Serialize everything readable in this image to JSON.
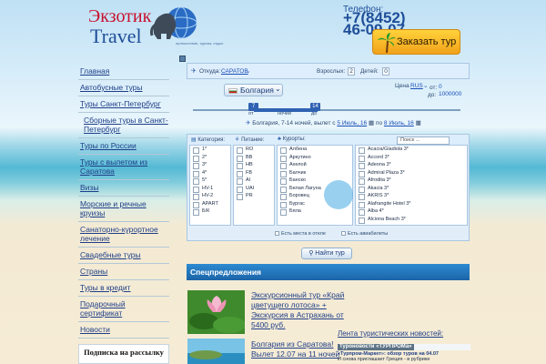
{
  "logo": {
    "line1": "Экзотик",
    "line2": "Travel",
    "tagline": "путешествия, туризм, отдых"
  },
  "contact": {
    "phone_label": "Телефон:",
    "phone_number": "+7(8452) 46-09-07"
  },
  "order_button": {
    "label": "Заказать тур"
  },
  "menu": {
    "items": [
      "Главная",
      "Автобусные туры",
      "Туры Санкт-Петербург",
      "Сборные туры в Санкт-Петербург",
      "Туры по России",
      "Туры с вылетом из Саратова",
      "Визы",
      "Морские и речные круизы",
      "Санаторно-курортное лечение",
      "Свадебные туры",
      "Страны",
      "Туры в кредит",
      "Подарочный сертификат",
      "Новости"
    ]
  },
  "subscribe": {
    "label": "Подписка на рассылку"
  },
  "search": {
    "from_label": "Откуда:",
    "from_value": "САРАТОВ",
    "adults_label": "Взрослых:",
    "adults_value": "2",
    "children_label": "Детей:",
    "children_value": "0",
    "country": "Болгария",
    "price_label": "Цена",
    "currency": "RUS",
    "price_from_label": "от:",
    "price_from": "0",
    "price_to_label": "до:",
    "price_to": "1000000",
    "nights_from": "7",
    "nights_to": "14",
    "nights_from_label": "от",
    "nights_label": "ночей",
    "nights_to_label": "до",
    "summary_prefix": "Болгария, 7-14 ночей, вылет",
    "date_from_label": "с",
    "date_from": "5 Июль, 16",
    "date_to_label": "по",
    "date_to": "8 Июль, 16"
  },
  "filters": {
    "category_label": "Категория:",
    "food_label": "Питание:",
    "resorts_label": "Курорты:",
    "search_placeholder": "Поиск ...",
    "categories": [
      "1*",
      "2*",
      "3*",
      "4*",
      "5*",
      "HV-1",
      "HV-2",
      "APART",
      "Б/К"
    ],
    "meals": [
      "RO",
      "BB",
      "HB",
      "FB",
      "AI",
      "UAI",
      "PR"
    ],
    "resorts": [
      "Албена",
      "Аркутино",
      "Ахелой",
      "Балчик",
      "Банско",
      "Белая Лагуна",
      "Боровец",
      "Бургас",
      "Бяла"
    ],
    "hotels": [
      "Acacia/Gladiola 3*",
      "Accord 3*",
      "Adeona 3*",
      "Admiral Plaza 3*",
      "Afrodita 3*",
      "Akacia 3*",
      "AKRIS 3*",
      "Alafrangite Hotel 3*",
      "Alba 4*",
      "Alciona Beach 3*"
    ],
    "check_seats_hotel": "Есть места в отеле",
    "check_seats_air": "Есть авиабилеты"
  },
  "find_button": {
    "label": "Найти тур"
  },
  "specials": {
    "header": "Спецпредложения",
    "offers": [
      {
        "title": "Экскурсионный тур «Край цветущего лотоса» + Экскурсия в Астрахань от 5400 руб."
      },
      {
        "title": "Болгария из Саратова! Вылет 12.07 на 11 ночей"
      }
    ]
  },
  "news": {
    "heading": "Лента туристических новостей:",
    "tab_label": "Туроновости «ТУРПРОМа»",
    "item_title": "«Турпром-Маркет»: обзор туров на 04.07",
    "item_text": "И снова приглашает Греция - в рубрике"
  },
  "colors": {
    "accent": "#1f4e99",
    "brand_red": "#c8102e",
    "button_orange": "#f2a21b",
    "special_header": "#1c64a8"
  }
}
